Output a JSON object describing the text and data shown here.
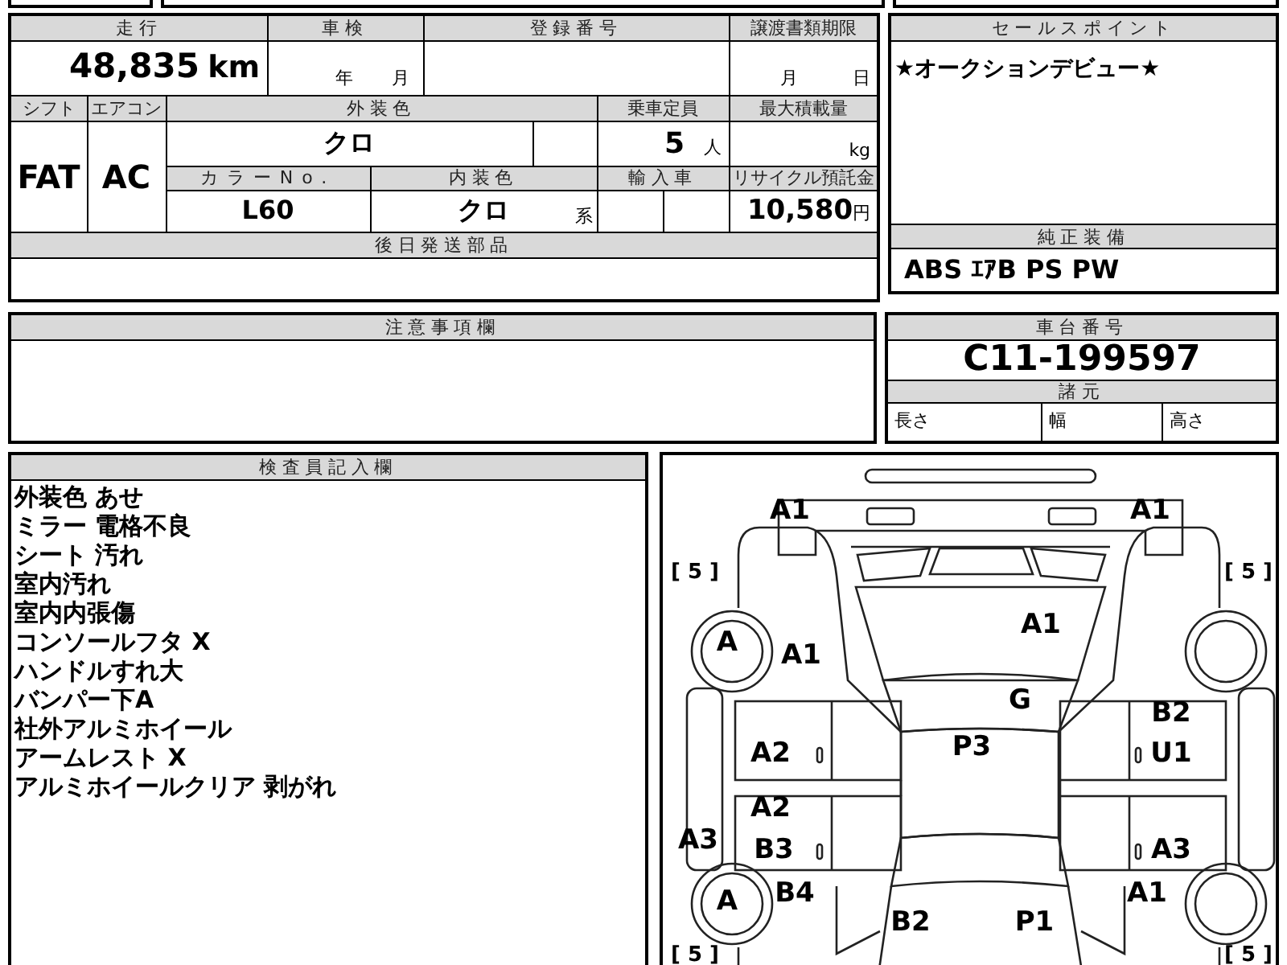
{
  "info_table": {
    "mileage": {
      "label": "走行",
      "value": "48,835",
      "unit": "km"
    },
    "inspection": {
      "label": "車検",
      "year_unit": "年",
      "month_unit": "月"
    },
    "registration": {
      "label": "登録番号"
    },
    "transfer_deadline": {
      "label": "譲渡書類期限",
      "month_unit": "月",
      "day_unit": "日"
    },
    "shift": {
      "label": "シフト",
      "value": "FAT"
    },
    "aircon": {
      "label": "エアコン",
      "value": "AC"
    },
    "exterior_color": {
      "label": "外装色",
      "value": "クロ"
    },
    "capacity": {
      "label": "乗車定員",
      "value": "5",
      "unit": "人"
    },
    "max_load": {
      "label": "最大積載量",
      "unit": "kg"
    },
    "color_no": {
      "label": "カラーNo.",
      "value": "L60"
    },
    "interior_color": {
      "label": "内装色",
      "value": "クロ",
      "unit": "系"
    },
    "imported": {
      "label": "輸入車"
    },
    "recycling_fee": {
      "label": "リサイクル預託金",
      "value": "10,580",
      "unit": "円"
    },
    "parts_later": {
      "label": "後日発送部品"
    }
  },
  "sales_point": {
    "label": "セールスポイント",
    "text": "★オークションデビュー★"
  },
  "equipment": {
    "label": "純正装備",
    "text": "ABS ｴｱB PS PW"
  },
  "notes": {
    "label": "注意事項欄"
  },
  "chassis": {
    "label": "車台番号",
    "value": "C11-199597"
  },
  "specs": {
    "label": "諸元",
    "items": [
      "長さ",
      "幅",
      "高さ"
    ]
  },
  "inspector_notes": {
    "label": "検査員記入欄",
    "lines": [
      "外装色 あせ",
      "ミラー 電格不良",
      "シート 汚れ",
      "室内汚れ",
      "室内内張傷",
      "コンソールフタ X",
      "ハンドルすれ大",
      "バンパー下A",
      "社外アルミホイール",
      "アームレスト X",
      "アルミホイールクリア 剥がれ"
    ]
  },
  "damage_map": {
    "marks": {
      "front_bumper_left": "A1",
      "front_bumper_right": "A1",
      "hood": "A1",
      "tire_front_left": "A",
      "fender_front_left": "A1",
      "windshield": "G",
      "door_front_right_upper": "B2",
      "door_front_left": "A2",
      "roof": "P3",
      "door_front_right_lower": "U1",
      "door_rear_left_upper": "A2",
      "sill_left": "A3",
      "door_rear_left_lower": "B3",
      "door_rear_right": "A3",
      "tire_rear_left": "A",
      "fender_rear_left": "B4",
      "fender_rear_right": "A1",
      "trunk_left": "B2",
      "trunk_right": "P1"
    },
    "tire_treads": {
      "front_left": "[ 5 ]",
      "front_right": "[ 5 ]",
      "rear_left": "[ 5 ]",
      "rear_right": "[ 5 ]"
    }
  }
}
